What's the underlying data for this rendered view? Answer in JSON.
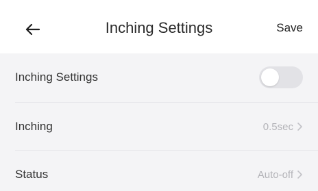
{
  "header": {
    "title": "Inching Settings",
    "save_label": "Save",
    "back_icon": "arrow-left-icon"
  },
  "rows": [
    {
      "label": "Inching Settings",
      "control": "toggle",
      "toggle_on": false
    },
    {
      "label": "Inching",
      "value": "0.5sec",
      "icon": "chevron-right-icon"
    },
    {
      "label": "Status",
      "value": "Auto-off",
      "icon": "chevron-right-icon"
    }
  ],
  "colors": {
    "header_bg": "#ffffff",
    "page_bg": "#f4f4f6",
    "toggle_off": "#e2e2e6",
    "value_text": "#b3b3b8"
  }
}
